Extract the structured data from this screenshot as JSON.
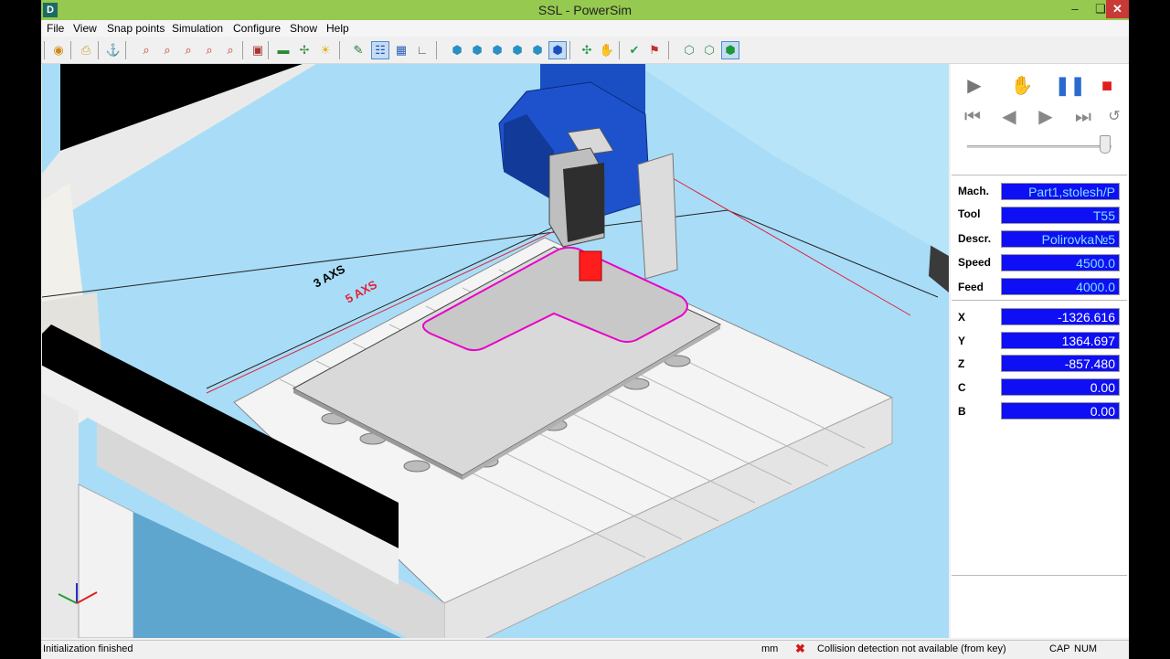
{
  "window": {
    "title": "SSL - PowerSim",
    "app_icon": "D"
  },
  "menu": [
    "File",
    "View",
    "Snap points",
    "Simulation",
    "Configure",
    "Show",
    "Help"
  ],
  "viewport": {
    "label_3axs": "3 AXS",
    "label_5axs": "5 AXS"
  },
  "controls": {
    "icons": [
      "play-icon",
      "hand-icon",
      "pause-icon",
      "stop-icon",
      "first-icon",
      "step-back-icon",
      "step-forward-icon",
      "last-icon",
      "rewind-icon"
    ],
    "slider_value": 0.98
  },
  "fields": [
    {
      "label": "Mach.",
      "value": "Part1,stolesh/P"
    },
    {
      "label": "Tool",
      "value": "T55"
    },
    {
      "label": "Descr.",
      "value": "Polirovka№5"
    },
    {
      "label": "Speed",
      "value": "4500.0"
    },
    {
      "label": "Feed",
      "value": "4000.0"
    }
  ],
  "coords": [
    {
      "label": "X",
      "value": "-1326.616"
    },
    {
      "label": "Y",
      "value": "1364.697"
    },
    {
      "label": "Z",
      "value": "-857.480"
    },
    {
      "label": "C",
      "value": "0.00"
    },
    {
      "label": "B",
      "value": "0.00"
    }
  ],
  "status": {
    "message": "Initialization finished",
    "units": "mm",
    "collision_icon": "x-icon",
    "collision": "Collision detection not available (from key)",
    "caps": "CAP",
    "num": "NUM"
  },
  "colors": {
    "titlebar": "#95c94f",
    "field_bg": "#0f0ff5",
    "spindle": "#1a4fc4",
    "toolpath": "#e800c8"
  }
}
